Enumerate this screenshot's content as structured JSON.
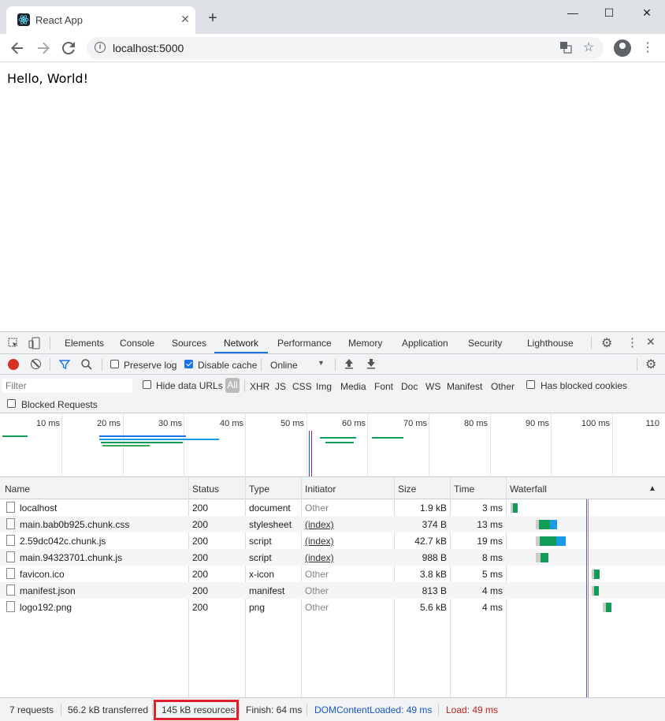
{
  "browser": {
    "tab_title": "React App",
    "tab_close": "✕",
    "new_tab": "+",
    "url": "localhost:5000",
    "window_controls": {
      "minimize": "—",
      "maximize": "☐",
      "close": "✕"
    }
  },
  "page": {
    "content": "Hello, World!"
  },
  "devtools": {
    "tabs": [
      "Elements",
      "Console",
      "Sources",
      "Network",
      "Performance",
      "Memory",
      "Application",
      "Security",
      "Lighthouse"
    ],
    "active_tab": "Network",
    "toolbar": {
      "preserve_log": "Preserve log",
      "disable_cache": "Disable cache",
      "throttle": "Online"
    },
    "filter": {
      "placeholder": "Filter",
      "hide_data_urls": "Hide data URLs",
      "types": [
        "All",
        "XHR",
        "JS",
        "CSS",
        "Img",
        "Media",
        "Font",
        "Doc",
        "WS",
        "Manifest",
        "Other"
      ],
      "has_blocked_cookies": "Has blocked cookies",
      "blocked_requests": "Blocked Requests"
    },
    "overview_ticks": [
      "10 ms",
      "20 ms",
      "30 ms",
      "40 ms",
      "50 ms",
      "60 ms",
      "70 ms",
      "80 ms",
      "90 ms",
      "100 ms",
      "110"
    ],
    "columns": [
      "Name",
      "Status",
      "Type",
      "Initiator",
      "Size",
      "Time",
      "Waterfall"
    ],
    "sort_icon": "▲",
    "rows": [
      {
        "name": "localhost",
        "status": "200",
        "type": "document",
        "initiator": "Other",
        "size": "1.9 kB",
        "time": "3 ms"
      },
      {
        "name": "main.bab0b925.chunk.css",
        "status": "200",
        "type": "stylesheet",
        "initiator": "(index)",
        "size": "374 B",
        "time": "13 ms"
      },
      {
        "name": "2.59dc042c.chunk.js",
        "status": "200",
        "type": "script",
        "initiator": "(index)",
        "size": "42.7 kB",
        "time": "19 ms"
      },
      {
        "name": "main.94323701.chunk.js",
        "status": "200",
        "type": "script",
        "initiator": "(index)",
        "size": "988 B",
        "time": "8 ms"
      },
      {
        "name": "favicon.ico",
        "status": "200",
        "type": "x-icon",
        "initiator": "Other",
        "size": "3.8 kB",
        "time": "5 ms"
      },
      {
        "name": "manifest.json",
        "status": "200",
        "type": "manifest",
        "initiator": "Other",
        "size": "813 B",
        "time": "4 ms"
      },
      {
        "name": "logo192.png",
        "status": "200",
        "type": "png",
        "initiator": "Other",
        "size": "5.6 kB",
        "time": "4 ms"
      }
    ],
    "status": {
      "requests": "7 requests",
      "transferred": "56.2 kB transferred",
      "resources": "145 kB resources",
      "finish": "Finish: 64 ms",
      "dom_content_loaded": "DOMContentLoaded: 49 ms",
      "load": "Load: 49 ms"
    },
    "colors": {
      "accent": "#1a73e8",
      "dcl": "#1a56c4",
      "load": "#c5221f",
      "highlight": "#e0202a",
      "record": "#d93025"
    }
  }
}
